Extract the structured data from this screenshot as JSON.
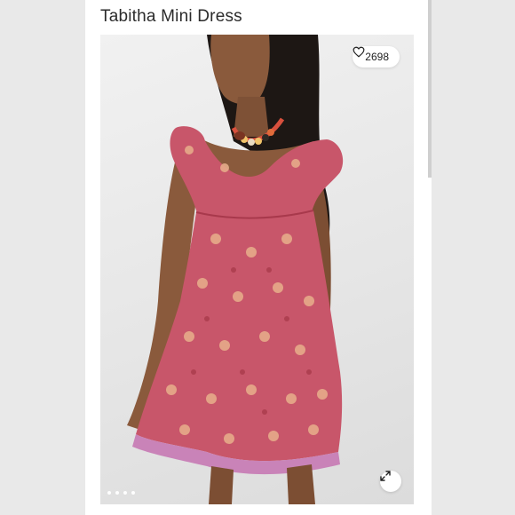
{
  "product": {
    "title": "Tabitha Mini Dress",
    "like_count": "2698"
  },
  "icons": {
    "like": "heart-icon",
    "expand": "expand-arrows-icon"
  },
  "carousel": {
    "dot_count": 4,
    "active_index": 0
  },
  "colors": {
    "dress": "#c8566a",
    "trim": "#c983b8",
    "background": "#e9e9e9"
  }
}
